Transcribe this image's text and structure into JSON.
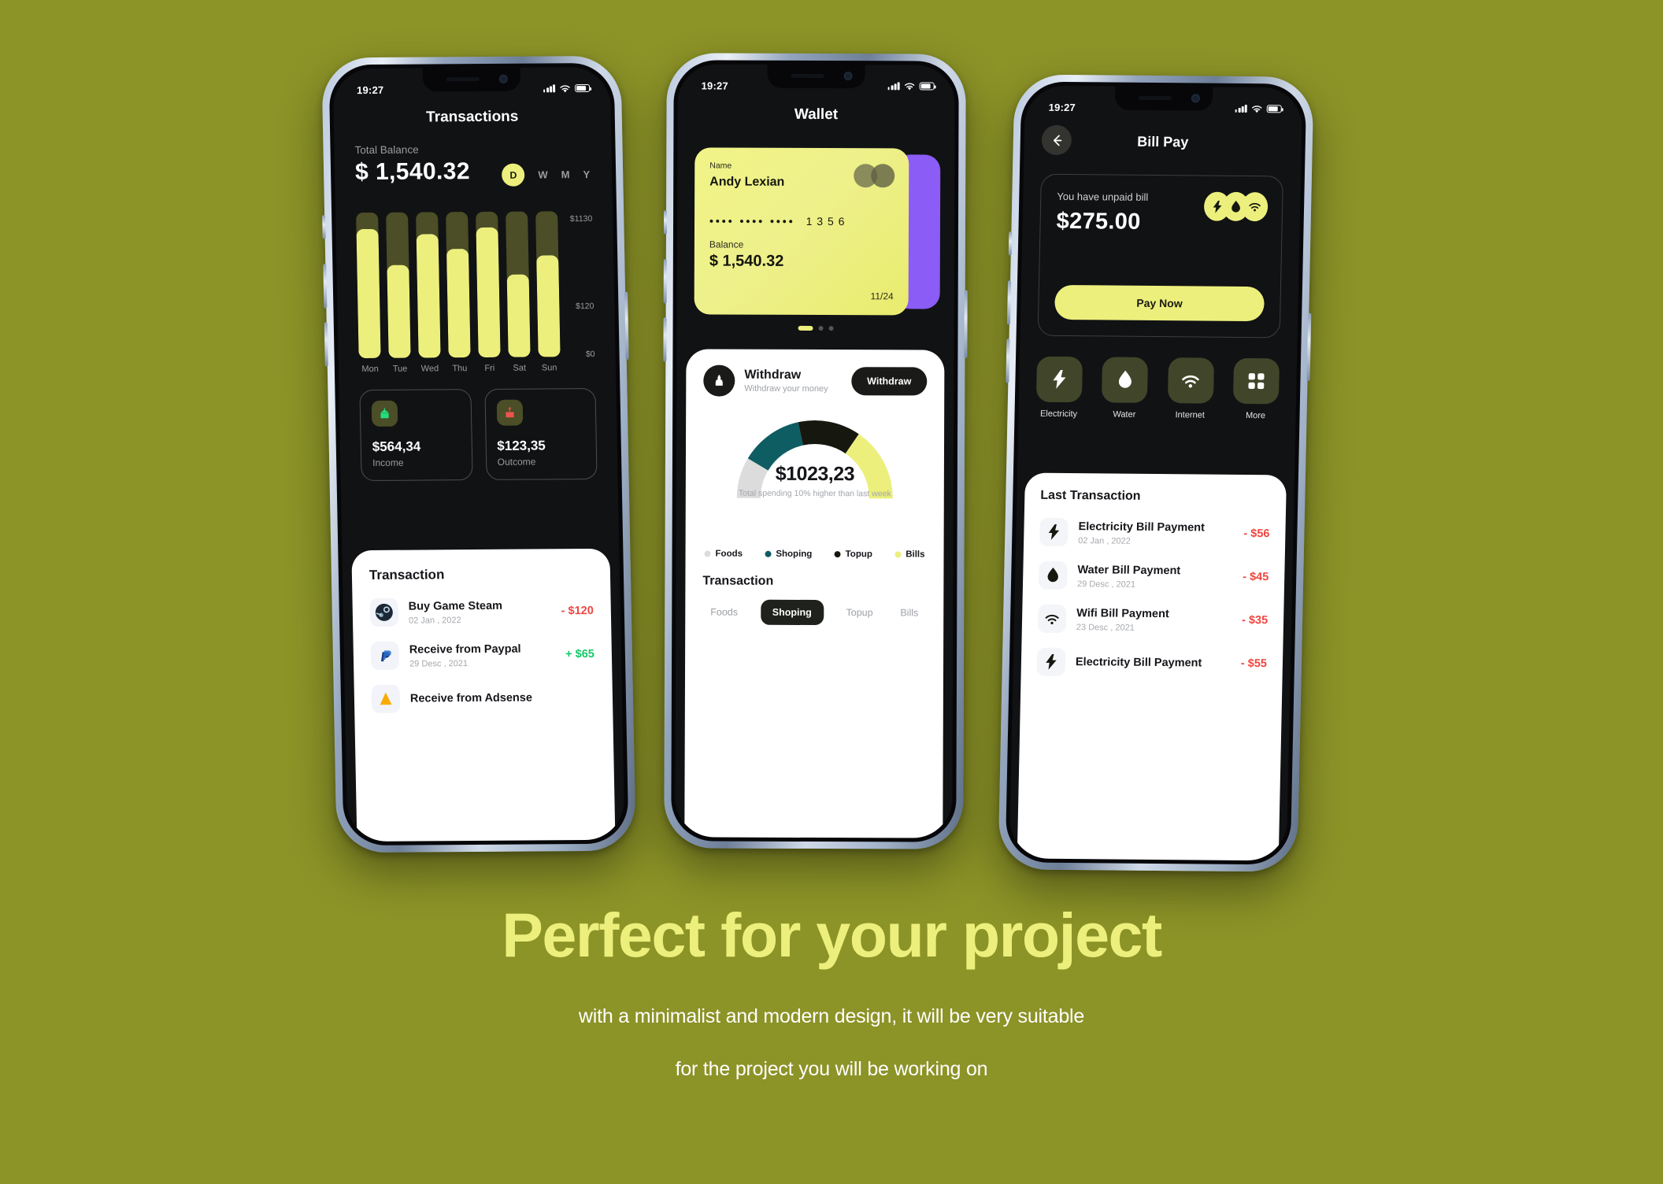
{
  "background_color": "#8c9327",
  "accent_yellow": "#ecef7c",
  "status_bar": {
    "time": "19:27",
    "signal_icon": "cellular-bars-icon",
    "wifi_icon": "wifi-icon",
    "battery_icon": "battery-icon"
  },
  "phone1": {
    "title": "Transactions",
    "balance_label": "Total Balance",
    "balance_value": "$ 1,540.32",
    "ranges": [
      {
        "label": "D",
        "selected": true
      },
      {
        "label": "W",
        "selected": false
      },
      {
        "label": "M",
        "selected": false
      },
      {
        "label": "Y",
        "selected": false
      }
    ],
    "chart_data": {
      "type": "bar",
      "title": "Total Balance",
      "categories": [
        "Mon",
        "Tue",
        "Wed",
        "Thu",
        "Fri",
        "Sat",
        "Sun"
      ],
      "values": [
        1000,
        720,
        960,
        840,
        1010,
        640,
        790
      ],
      "track_max": 1130,
      "ylabel": "",
      "xlabel": "",
      "ylim": [
        0,
        1130
      ],
      "ytick_labels": [
        "$1130",
        "$120",
        "$0"
      ],
      "ytick_values": [
        1130,
        120,
        0
      ],
      "grid": false,
      "bar_color": "#ecef7c",
      "track_color": "#4b4e26"
    },
    "stats": [
      {
        "icon": "income-arrow-icon",
        "value": "$564,34",
        "caption": "Income",
        "color": "#22dd7e"
      },
      {
        "icon": "outcome-arrow-icon",
        "value": "$123,35",
        "caption": "Outcome",
        "color": "#f0534f"
      }
    ],
    "sheet_title": "Transaction",
    "transactions": [
      {
        "icon": "steam-icon",
        "name": "Buy Game Steam",
        "date": "02 Jan , 2022",
        "amount": "- $120",
        "amount_color": "#f0453f"
      },
      {
        "icon": "paypal-icon",
        "name": "Receive from Paypal",
        "date": "29 Desc , 2021",
        "amount": "+ $65",
        "amount_color": "#17c767"
      },
      {
        "icon": "adsense-icon",
        "name": "Receive from Adsense",
        "date": "",
        "amount": "",
        "amount_color": "#17c767"
      }
    ]
  },
  "phone2": {
    "title": "Wallet",
    "card": {
      "name_label": "Name",
      "name": "Andy Lexian",
      "masked_number": "••••  ••••  ••••",
      "last4": "1 3 5 6",
      "balance_label": "Balance",
      "balance": "$ 1,540.32",
      "expiry": "11/24",
      "brand_icon": "mastercard-icon"
    },
    "carousel_dots": 3,
    "carousel_active": 0,
    "withdraw": {
      "icon": "withdraw-icon",
      "title": "Withdraw",
      "subtitle": "Withdraw your money",
      "button_label": "Withdraw"
    },
    "chart_data": {
      "type": "pie",
      "subtype": "half-donut-gauge",
      "title": "$1023,23",
      "center_value": "$1023,23",
      "annotation": "Total spending 10% higher than last week",
      "labels": [
        "Foods",
        "Shoping",
        "Topup",
        "Bills"
      ],
      "values": [
        17,
        26,
        26,
        31
      ],
      "colors": [
        "#dcdcdc",
        "#0e5d63",
        "#16180f",
        "#ecef7c"
      ],
      "legend_position": "bottom"
    },
    "legend": [
      {
        "label": "Foods",
        "color": "#dcdcdc"
      },
      {
        "label": "Shoping",
        "color": "#0e5d63"
      },
      {
        "label": "Topup",
        "color": "#16180f"
      },
      {
        "label": "Bills",
        "color": "#ecef7c"
      }
    ],
    "sheet_title": "Transaction",
    "tabs": [
      {
        "label": "Foods",
        "selected": false
      },
      {
        "label": "Shoping",
        "selected": true
      },
      {
        "label": "Topup",
        "selected": false
      },
      {
        "label": "Bills",
        "selected": false
      }
    ]
  },
  "phone3": {
    "title": "Bill Pay",
    "back_icon": "arrow-left-icon",
    "bill": {
      "label": "You have unpaid bill",
      "amount": "$275.00",
      "pay_button": "Pay Now",
      "icons": [
        "bolt-icon",
        "water-drop-icon",
        "wifi-icon"
      ]
    },
    "categories": [
      {
        "icon": "bolt-icon",
        "label": "Electricity"
      },
      {
        "icon": "water-drop-icon",
        "label": "Water"
      },
      {
        "icon": "wifi-icon",
        "label": "Internet"
      },
      {
        "icon": "grid-icon",
        "label": "More"
      }
    ],
    "sheet_title": "Last Transaction",
    "transactions": [
      {
        "icon": "bolt-icon",
        "name": "Electricity Bill Payment",
        "date": "02 Jan , 2022",
        "amount": "- $56"
      },
      {
        "icon": "water-drop-icon",
        "name": "Water Bill Payment",
        "date": "29 Desc , 2021",
        "amount": "- $45"
      },
      {
        "icon": "wifi-icon",
        "name": "Wifi Bill Payment",
        "date": "23 Desc , 2021",
        "amount": "- $35"
      },
      {
        "icon": "bolt-icon",
        "name": "Electricity Bill Payment",
        "date": "",
        "amount": "- $55"
      }
    ],
    "amount_color": "#f0453f"
  },
  "caption": {
    "headline": "Perfect for your project",
    "line1": "with a minimalist and modern design, it will be very suitable",
    "line2": "for the project you will be working on"
  }
}
